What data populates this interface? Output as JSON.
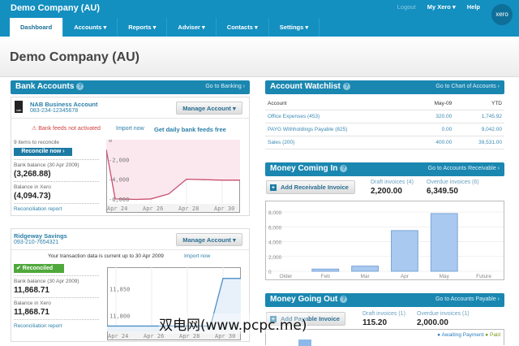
{
  "app": {
    "org": "Demo Company (AU)",
    "logout": "Logout",
    "my_xero": "My Xero ▾",
    "help": "Help",
    "logo": "xero"
  },
  "nav": [
    "Dashboard",
    "Accounts ▾",
    "Reports ▾",
    "Adviser ▾",
    "Contacts ▾",
    "Settings ▾"
  ],
  "page_title": "Demo Company (AU)",
  "bank": {
    "title": "Bank Accounts",
    "link": "Go to Banking ›",
    "nab": {
      "name": "NAB Business Account",
      "number": "083-234-12345678",
      "logo": "nab",
      "manage": "Manage Account ▾",
      "warn": "Bank feeds not activated",
      "import": "Import now",
      "feeds": "Get daily bank feeds free",
      "items": "9 items to reconcile",
      "reconcile": "Reconcile now ›",
      "bank_label": "Bank balance (30 Apr 2009)",
      "bank_value": "(3,268.88)",
      "xero_label": "Balance in Xero",
      "xero_value": "(4,094.73)",
      "report": "Reconciliation report",
      "chart": {
        "xticks": [
          "Apr 24",
          "Apr 26",
          "Apr 28",
          "Apr 30"
        ],
        "xtickvals": [
          24,
          26,
          28,
          30
        ],
        "yticks": [
          "0",
          "-2,000",
          "-4,000",
          "-6,000"
        ],
        "ytickvals": [
          0,
          -2000,
          -4000,
          -6000
        ],
        "xlim": [
          23.5,
          31
        ],
        "ylim": [
          -6500,
          0
        ],
        "x": [
          23.5,
          24,
          25.2,
          26,
          27,
          28,
          30,
          31
        ],
        "y": [
          -1000,
          -6000,
          -6050,
          -6000,
          -5500,
          -4000,
          -4100,
          -4100
        ],
        "color": "#c94d6e",
        "fill": "#fbe8ee"
      }
    },
    "ridgeway": {
      "name": "Ridgeway Savings",
      "number": "093-210-7654321",
      "manage": "Manage Account ▾",
      "current": "Your transaction data is current up to 30 Apr 2009",
      "import": "Import now",
      "reconciled": "✔ Reconciled",
      "bank_label": "Bank balance (30 Apr 2009)",
      "bank_value": "11,868.71",
      "xero_label": "Balance in Xero",
      "xero_value": "11,868.71",
      "report": "Reconciliation report",
      "chart": {
        "xticks": [
          "Apr 24",
          "Apr 26",
          "Apr 28",
          "Apr 30"
        ],
        "xtickvals": [
          24,
          26,
          28,
          30
        ],
        "yticks": [
          "11,850",
          "11,800"
        ],
        "ytickvals": [
          11850,
          11800
        ],
        "xlim": [
          23.5,
          31
        ],
        "ylim": [
          11770,
          11890
        ],
        "x": [
          23.5,
          29.3,
          30,
          31
        ],
        "y": [
          11780,
          11780,
          11869,
          11869
        ],
        "color": "#4a8fc6",
        "fill": "#e8f1fa"
      }
    }
  },
  "watchlist": {
    "title": "Account Watchlist",
    "link": "Go to Chart of Accounts ›",
    "headers": [
      "Account",
      "May-09",
      "YTD"
    ],
    "rows": [
      [
        "Office Expenses (453)",
        "320.00",
        "1,745.92"
      ],
      [
        "PAYG Withholdings Payable (825)",
        "0.00",
        "9,042.00"
      ],
      [
        "Sales (200)",
        "400.00",
        "39,531.00"
      ]
    ]
  },
  "money_in": {
    "title": "Money Coming In",
    "link": "Go to Accounts Receivable ›",
    "add": "Add Receivable Invoice",
    "draft_label": "Draft invoices (4)",
    "draft_value": "2,200.00",
    "overdue_label": "Overdue invoices (6)",
    "overdue_value": "6,349.50"
  },
  "chart_data": {
    "type": "bar",
    "categories": [
      "Older",
      "Feb",
      "Mar",
      "Apr",
      "May",
      "Future"
    ],
    "values": [
      0,
      300,
      700,
      5500,
      7800,
      0
    ],
    "yticks": [
      "0",
      "2,000",
      "4,000",
      "6,000",
      "8,000"
    ],
    "ytickvals": [
      0,
      2000,
      4000,
      6000,
      8000
    ],
    "ylim": [
      0,
      9000
    ]
  },
  "money_out": {
    "title": "Money Going Out",
    "link": "Go to Accounts Payable ›",
    "add": "Add Payable Invoice",
    "draft_label": "Draft invoices (1)",
    "draft_value": "115.20",
    "overdue_label": "Overdue invoices (1)",
    "overdue_value": "2,000.00",
    "legend": [
      "● Awaiting Payment",
      "● Paid"
    ]
  },
  "watermark": "双电网(www.pcpc.me)"
}
